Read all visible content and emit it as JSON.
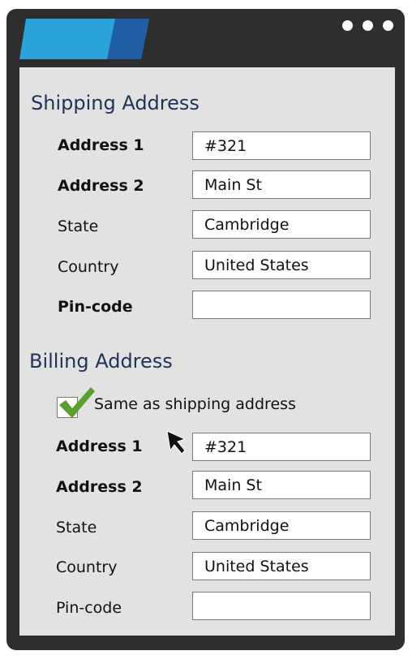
{
  "colors": {
    "window_frame": "#2e2e2e",
    "content_bg": "#e2e2e2",
    "section_title": "#1f3358",
    "tab_light": "#29a3da",
    "tab_dark": "#1f5da5",
    "check": "#5aa02c"
  },
  "window": {
    "controls": [
      "dot",
      "dot",
      "dot"
    ]
  },
  "shipping": {
    "title": "Shipping Address",
    "fields": [
      {
        "label": "Address 1",
        "value": "#321"
      },
      {
        "label": "Address 2",
        "value": "Main St"
      },
      {
        "label": "State",
        "value": "Cambridge"
      },
      {
        "label": "Country",
        "value": "United States"
      },
      {
        "label": "Pin-code",
        "value": ""
      }
    ]
  },
  "billing": {
    "title": "Billing Address",
    "same_as_shipping": {
      "label": "Same as shipping address",
      "checked": true,
      "icon": "checkmark-icon"
    },
    "fields": [
      {
        "label": "Address 1",
        "value": "#321"
      },
      {
        "label": "Address 2",
        "value": "Main St"
      },
      {
        "label": "State",
        "value": "Cambridge"
      },
      {
        "label": "Country",
        "value": "United States"
      },
      {
        "label": "Pin-code",
        "value": ""
      }
    ]
  },
  "cursor_icon": "mouse-pointer-icon"
}
